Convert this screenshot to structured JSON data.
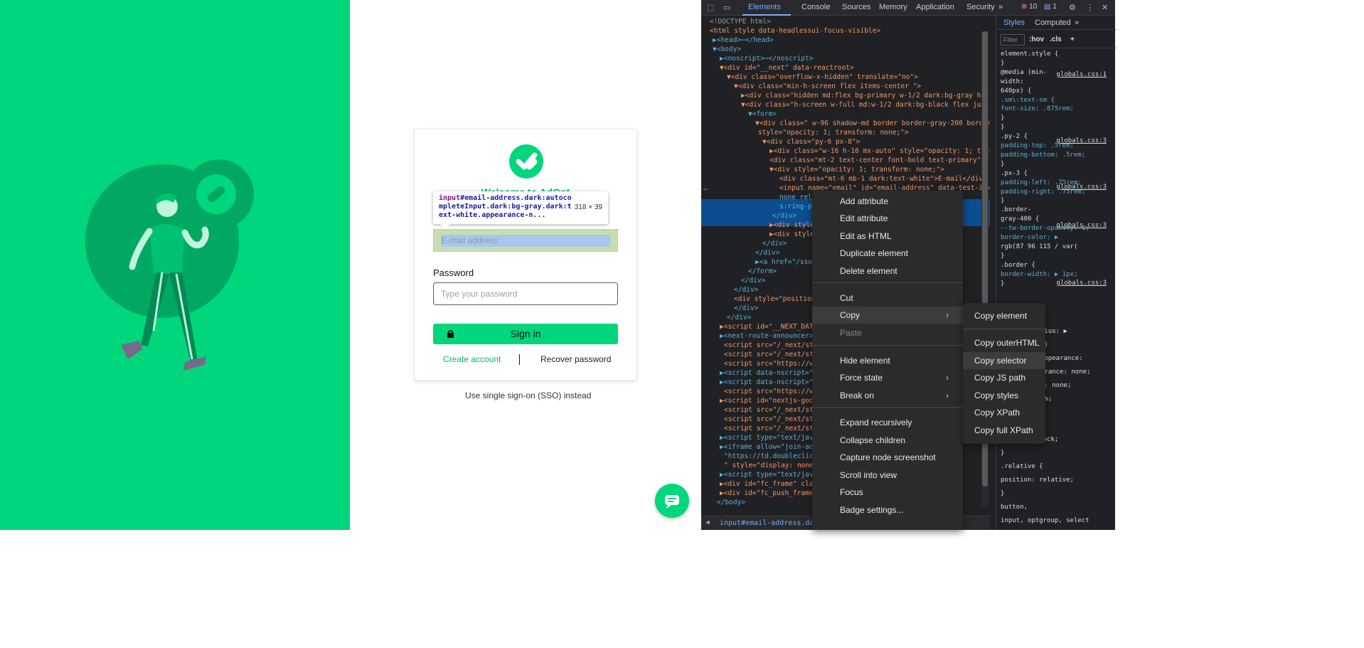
{
  "page": {
    "welcome": "Welcome to AdOpt",
    "email_placeholder": "E-mail address",
    "password_label": "Password",
    "password_placeholder": "Type your password",
    "signin_label": "Sign in",
    "create_account": "Create account",
    "recover_password": "Recover password",
    "sso_link": "Use single sign-on (SSO) instead",
    "colors": {
      "brand_green": "#00d67c",
      "dark_green": "#008a55"
    }
  },
  "inspect_tooltip": {
    "tag": "input",
    "selector": "#email-address.dark:autocompleteInput.dark:bg-gray.dark:text-white.appearance-n...",
    "dims": "318 × 39"
  },
  "devtools": {
    "tabs": [
      "Elements",
      "Console",
      "Sources",
      "Memory",
      "Application",
      "Security"
    ],
    "active_tab": "Elements",
    "more_tabs": "»",
    "errors_count": "10",
    "messages_count": "1",
    "styles_tabs": [
      "Styles",
      "Computed"
    ],
    "styles_more": "»",
    "filter_placeholder": "Filter",
    "hov": ":hov",
    ".cls": ".cls",
    "breadcrumb": "input#email-address.dark\\:au",
    "breadcrumb_tail": ".appea"
  },
  "dom_lines": [
    {
      "t": "<!DOCTYPE html>"
    },
    {
      "t": "<html style data-headlessui-focus-visible>"
    },
    {
      "t": "▶<head>⋯</head>"
    },
    {
      "t": "▼<body>"
    },
    {
      "t": "▶<noscript>⋯</noscript>"
    },
    {
      "t": "▼<div id=\"__next\" data-reactroot>"
    },
    {
      "t": "▼<div class=\"overflow-x-hidden\" translate=\"no\">"
    },
    {
      "t": "▼<div class=\"min-h-screen flex items-center \">"
    },
    {
      "t": "▶<div class=\"hidden md:flex bg-primary w-1/2 dark:bg-gray h-scree"
    },
    {
      "t": "▼<div class=\"h-screen w-full md:w-1/2 dark:bg-black flex justify-"
    },
    {
      "t": "▼<form>"
    },
    {
      "t": "▼<div class=\" w-96 shadow-md border border-gray-200 border-op"
    },
    {
      "t": "style=\"opacity: 1; transform: none;\">"
    },
    {
      "t": "▼<div class=\"py-6 px-8\">"
    },
    {
      "t": "▶<div class=\"w-16 h-16 mx-auto\" style=\"opacity: 1; transf"
    },
    {
      "t": "<div class=\"mt-2 text-center font-bold text-primary\" sty"
    },
    {
      "t": "▼<div style=\"opacity: 1; transform: none;\">"
    },
    {
      "t": "<div class=\"mt-6 mb-1 dark:text-white\">E-mail</div>"
    },
    {
      "t": "<input name=\"email\" id=\"email-address\" data-test-id=\"en"
    },
    {
      "t": "none rela                                 rder-gray"
    },
    {
      "t": "s:ring-p                                  m:text-"
    },
    {
      "t": "</div>"
    },
    {
      "t": "▶<div style"
    },
    {
      "t": "▶<div style"
    },
    {
      "t": "</div>"
    },
    {
      "t": "</div>"
    },
    {
      "t": "▶<a href=\"/sso/"
    },
    {
      "t": "</form>"
    },
    {
      "t": "</div>"
    },
    {
      "t": "</div>"
    },
    {
      "t": "<div style=\"position                        inter-e"
    },
    {
      "t": "</div>"
    },
    {
      "t": "</div>"
    },
    {
      "t": "▶<script id=\"__NEXT_DATA"
    },
    {
      "t": "▶<next-route-announcer>"
    },
    {
      "t": "<script src=\"/_next/sta"
    },
    {
      "t": "<script src=\"/_next/sta"
    },
    {
      "t": "<script src=\"https://ww"
    },
    {
      "t": "▶<script data-nscript=\"a"
    },
    {
      "t": "▶<script data-nscript=\"a"
    },
    {
      "t": "<script src=\"https://ww"
    },
    {
      "t": "▶<script id=\"nextjs-goog"
    },
    {
      "t": "<script src=\"/_next/sta"
    },
    {
      "t": "<script src=\"/_next/sta"
    },
    {
      "t": "<script src=\"/_next/sta"
    },
    {
      "t": "▶<script type=\"text/java"
    },
    {
      "t": "▶<iframe allow=\"join-ad-                      302292"
    },
    {
      "t": "\"https://td.doubleclick                        164&cv="
    },
    {
      "t": "\" style=\"display: none;"
    },
    {
      "t": "▶<script type=\"text/java"
    },
    {
      "t": "▶<div id=\"fc_frame\" clas                     tom: 15"
    },
    {
      "t": "▶<div id=\"fc_push_frame\""
    },
    {
      "t": "</body>"
    }
  ],
  "styles": [
    {
      "t": "element.style {"
    },
    {
      "t": "}"
    },
    {
      "t": "@media (min-"
    },
    {
      "t": "width:"
    },
    {
      "t": "640px) {"
    },
    {
      "t": " .sm\\:text-sm {"
    },
    {
      "t": "   font-size: .875rem;"
    },
    {
      "t": " }"
    },
    {
      "t": "}"
    },
    {
      "t": ".py-2 {"
    },
    {
      "t": "  padding-top: .5rem;"
    },
    {
      "t": "  padding-bottom: .5rem;"
    },
    {
      "t": "}"
    },
    {
      "t": ".px-3 {"
    },
    {
      "t": "  padding-left: .75rem;"
    },
    {
      "t": "  padding-right: .75rem;"
    },
    {
      "t": "}"
    },
    {
      "t": ".border-"
    },
    {
      "t": "gray-400 {"
    },
    {
      "t": "  --tw-border-opacity: 1;"
    },
    {
      "t": "  border-color: ▶"
    },
    {
      "t": "    rgb(87 96 115 / var("
    },
    {
      "t": "}"
    },
    {
      "t": ".border {"
    },
    {
      "t": "  border-width: ▶ 1px;"
    },
    {
      "t": "}"
    }
  ],
  "styles_src": "globals.css:1",
  "styles_src3": "globals.css:3",
  "styles_bottom": [
    {
      "t": "dius: ▶"
    },
    {
      "t": "0)"
    },
    {
      "t": "appearance:"
    },
    {
      "t": "arance: none;"
    },
    {
      "t": "e: none;"
    },
    {
      "t": "0%;"
    },
    {
      "t": "}"
    },
    {
      "t": ".block {"
    },
    {
      "t": "  display: block;"
    },
    {
      "t": "}"
    },
    {
      "t": ".relative {"
    },
    {
      "t": "  position: relative;"
    },
    {
      "t": "}"
    },
    {
      "t": "button,"
    },
    {
      "t": "input, optgroup, select"
    }
  ],
  "context_menu": {
    "items": [
      {
        "label": "Add attribute"
      },
      {
        "label": "Edit attribute"
      },
      {
        "label": "Edit as HTML"
      },
      {
        "label": "Duplicate element"
      },
      {
        "label": "Delete element"
      },
      {
        "label": "Cut"
      },
      {
        "label": "Copy",
        "submenu": true
      },
      {
        "label": "Paste",
        "disabled": true
      },
      {
        "label": "Hide element"
      },
      {
        "label": "Force state",
        "submenu": true
      },
      {
        "label": "Break on",
        "submenu": true
      },
      {
        "label": "Expand recursively"
      },
      {
        "label": "Collapse children"
      },
      {
        "label": "Capture node screenshot"
      },
      {
        "label": "Scroll into view"
      },
      {
        "label": "Focus"
      },
      {
        "label": "Badge settings..."
      }
    ],
    "submenu_arrow": "›"
  },
  "copy_submenu": {
    "items": [
      "Copy element",
      "Copy outerHTML",
      "Copy selector",
      "Copy JS path",
      "Copy styles",
      "Copy XPath",
      "Copy full XPath"
    ]
  }
}
